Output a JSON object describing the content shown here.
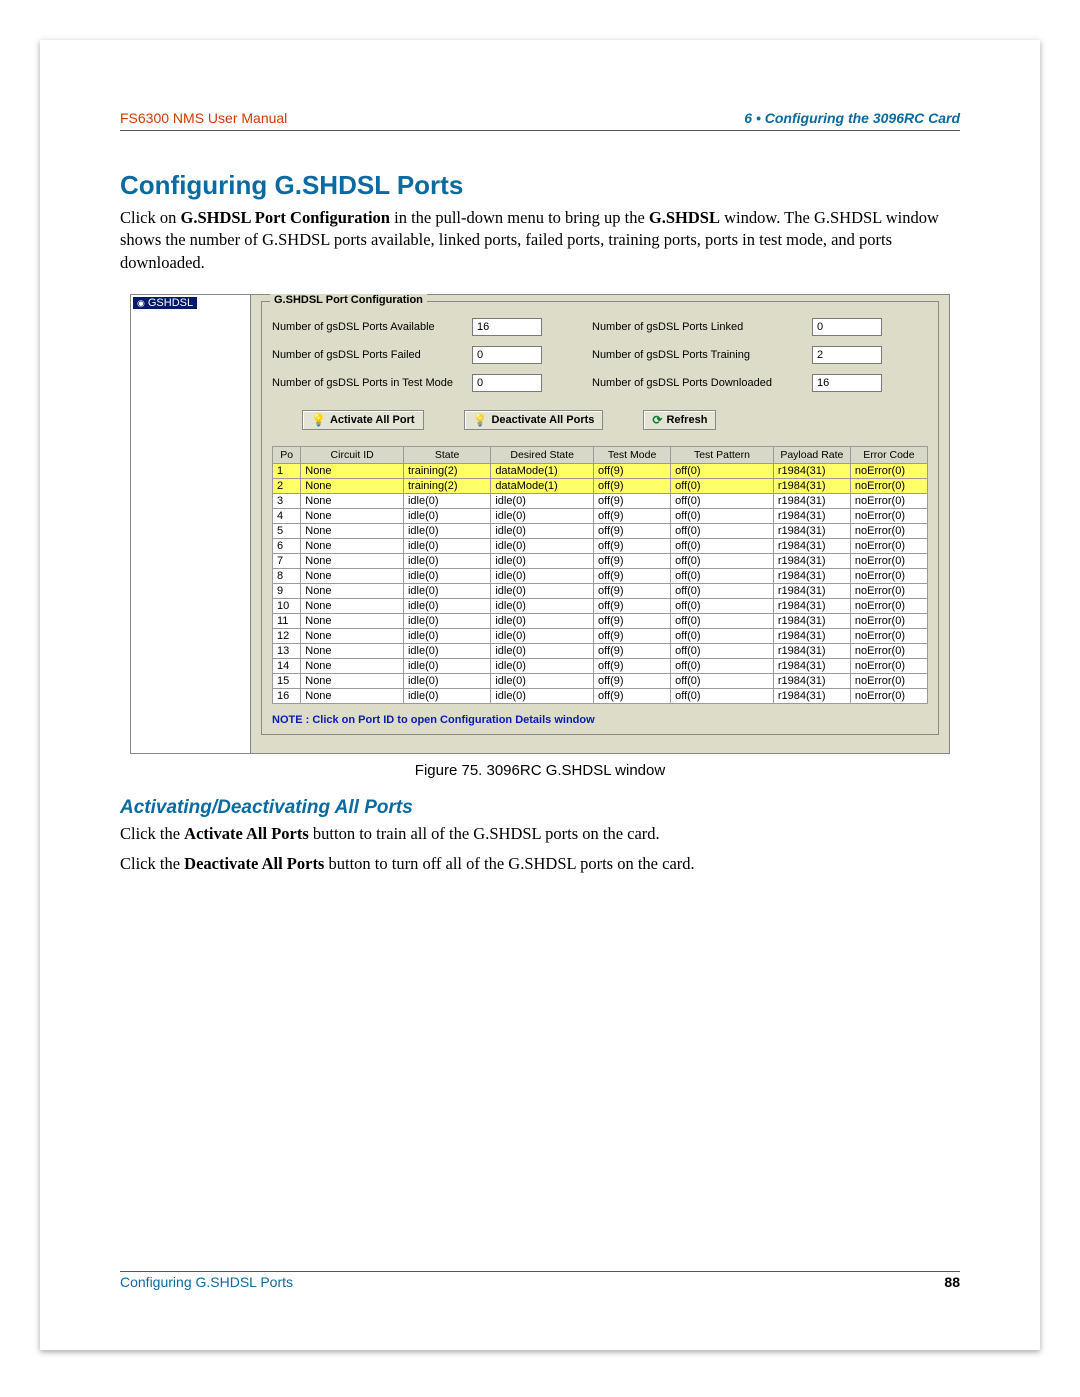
{
  "header": {
    "left": "FS6300 NMS User Manual",
    "right": "6 • Configuring the 3096RC Card"
  },
  "heading1": "Configuring G.SHDSL Ports",
  "intro_a": "Click on ",
  "intro_b_bold": "G.SHDSL Port Configuration",
  "intro_c": " in the pull-down menu to bring up the ",
  "intro_d_bold": "G.SHDSL",
  "intro_e": " window. The G.SHDSL window shows the number of G.SHDSL ports available, linked ports, failed ports, training ports, ports in test mode, and ports downloaded.",
  "tree_label": "GSHDSL",
  "fieldset_legend": "G.SHDSL Port Configuration",
  "stats": {
    "r1l": "Number of gsDSL Ports Available",
    "r1v": "16",
    "r1r": "Number of gsDSL Ports Linked",
    "r1rv": "0",
    "r2l": "Number of gsDSL Ports Failed",
    "r2v": "0",
    "r2r": "Number of gsDSL Ports Training",
    "r2rv": "2",
    "r3l": "Number of gsDSL Ports in Test Mode",
    "r3v": "0",
    "r3r": "Number of gsDSL Ports Downloaded",
    "r3rv": "16"
  },
  "buttons": {
    "activate": "Activate All Port",
    "deactivate": "Deactivate All Ports",
    "refresh": "Refresh"
  },
  "columns": {
    "po": "Po",
    "cir": "Circuit ID",
    "st": "State",
    "des": "Desired State",
    "tm": "Test Mode",
    "tp": "Test Pattern",
    "pr": "Payload Rate",
    "ec": "Error Code"
  },
  "rows": [
    {
      "hi": true,
      "po": "1",
      "cir": "None",
      "st": "training(2)",
      "des": "dataMode(1)",
      "tm": "off(9)",
      "tp": "off(0)",
      "pr": "r1984(31)",
      "ec": "noError(0)"
    },
    {
      "hi": true,
      "po": "2",
      "cir": "None",
      "st": "training(2)",
      "des": "dataMode(1)",
      "tm": "off(9)",
      "tp": "off(0)",
      "pr": "r1984(31)",
      "ec": "noError(0)"
    },
    {
      "po": "3",
      "cir": "None",
      "st": "idle(0)",
      "des": "idle(0)",
      "tm": "off(9)",
      "tp": "off(0)",
      "pr": "r1984(31)",
      "ec": "noError(0)"
    },
    {
      "po": "4",
      "cir": "None",
      "st": "idle(0)",
      "des": "idle(0)",
      "tm": "off(9)",
      "tp": "off(0)",
      "pr": "r1984(31)",
      "ec": "noError(0)"
    },
    {
      "po": "5",
      "cir": "None",
      "st": "idle(0)",
      "des": "idle(0)",
      "tm": "off(9)",
      "tp": "off(0)",
      "pr": "r1984(31)",
      "ec": "noError(0)"
    },
    {
      "po": "6",
      "cir": "None",
      "st": "idle(0)",
      "des": "idle(0)",
      "tm": "off(9)",
      "tp": "off(0)",
      "pr": "r1984(31)",
      "ec": "noError(0)"
    },
    {
      "po": "7",
      "cir": "None",
      "st": "idle(0)",
      "des": "idle(0)",
      "tm": "off(9)",
      "tp": "off(0)",
      "pr": "r1984(31)",
      "ec": "noError(0)"
    },
    {
      "po": "8",
      "cir": "None",
      "st": "idle(0)",
      "des": "idle(0)",
      "tm": "off(9)",
      "tp": "off(0)",
      "pr": "r1984(31)",
      "ec": "noError(0)"
    },
    {
      "po": "9",
      "cir": "None",
      "st": "idle(0)",
      "des": "idle(0)",
      "tm": "off(9)",
      "tp": "off(0)",
      "pr": "r1984(31)",
      "ec": "noError(0)"
    },
    {
      "po": "10",
      "cir": "None",
      "st": "idle(0)",
      "des": "idle(0)",
      "tm": "off(9)",
      "tp": "off(0)",
      "pr": "r1984(31)",
      "ec": "noError(0)"
    },
    {
      "po": "11",
      "cir": "None",
      "st": "idle(0)",
      "des": "idle(0)",
      "tm": "off(9)",
      "tp": "off(0)",
      "pr": "r1984(31)",
      "ec": "noError(0)"
    },
    {
      "po": "12",
      "cir": "None",
      "st": "idle(0)",
      "des": "idle(0)",
      "tm": "off(9)",
      "tp": "off(0)",
      "pr": "r1984(31)",
      "ec": "noError(0)"
    },
    {
      "po": "13",
      "cir": "None",
      "st": "idle(0)",
      "des": "idle(0)",
      "tm": "off(9)",
      "tp": "off(0)",
      "pr": "r1984(31)",
      "ec": "noError(0)"
    },
    {
      "po": "14",
      "cir": "None",
      "st": "idle(0)",
      "des": "idle(0)",
      "tm": "off(9)",
      "tp": "off(0)",
      "pr": "r1984(31)",
      "ec": "noError(0)"
    },
    {
      "po": "15",
      "cir": "None",
      "st": "idle(0)",
      "des": "idle(0)",
      "tm": "off(9)",
      "tp": "off(0)",
      "pr": "r1984(31)",
      "ec": "noError(0)"
    },
    {
      "po": "16",
      "cir": "None",
      "st": "idle(0)",
      "des": "idle(0)",
      "tm": "off(9)",
      "tp": "off(0)",
      "pr": "r1984(31)",
      "ec": "noError(0)"
    }
  ],
  "note": "NOTE : Click on Port ID to open Configuration Details window",
  "caption": "Figure 75. 3096RC G.SHDSL window",
  "heading2": "Activating/Deactivating All Ports",
  "p2_a": "Click the ",
  "p2_b_bold": "Activate All Ports",
  "p2_c": " button to train all of the G.SHDSL ports on the card.",
  "p3_a": "Click the ",
  "p3_b_bold": "Deactivate All Ports",
  "p3_c": " button to turn off all of the G.SHDSL ports on the card.",
  "footer": {
    "left": "Configuring G.SHDSL Ports",
    "right": "88"
  }
}
